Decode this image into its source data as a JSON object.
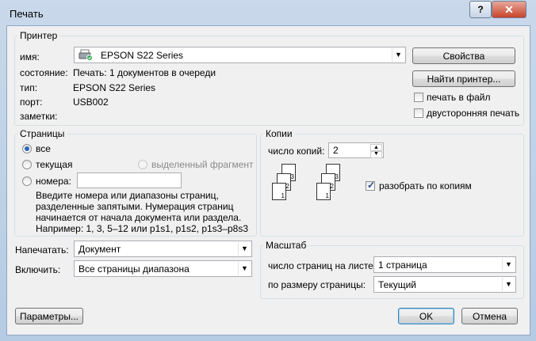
{
  "window": {
    "title": "Печать",
    "help_label": "?",
    "close_label": "✕"
  },
  "printer": {
    "group_label": "Принтер",
    "name_label": "имя:",
    "name_value": "EPSON S22 Series",
    "status_label": "состояние:",
    "status_value": "Печать: 1 документов в очереди",
    "type_label": "тип:",
    "type_value": "EPSON S22 Series",
    "port_label": "порт:",
    "port_value": "USB002",
    "notes_label": "заметки:",
    "properties_button": "Свойства",
    "find_button": "Найти принтер...",
    "print_to_file": {
      "label": "печать в файл",
      "checked": false
    },
    "duplex": {
      "label": "двусторонняя печать",
      "checked": false
    }
  },
  "pages": {
    "group_label": "Страницы",
    "all": {
      "label": "все",
      "selected": true
    },
    "current": {
      "label": "текущая",
      "selected": false
    },
    "selection": {
      "label": "выделенный фрагмент",
      "enabled": false
    },
    "numbers": {
      "label": "номера:",
      "value": ""
    },
    "hint_lines": [
      "Введите номера или диапазоны страниц,",
      "разделенные запятыми. Нумерация страниц",
      "начинается от начала документа или раздела.",
      "Например: 1, 3, 5–12 или p1s1, p1s2, p1s3–p8s3"
    ]
  },
  "copies": {
    "group_label": "Копии",
    "count_label": "число копий:",
    "count_value": "2",
    "collate": {
      "label": "разобрать по копиям",
      "checked": true
    },
    "page_numbers": [
      "3",
      "2",
      "1"
    ]
  },
  "print_what": {
    "label": "Напечатать:",
    "value": "Документ"
  },
  "include": {
    "label": "Включить:",
    "value": "Все страницы диапазона"
  },
  "zoom": {
    "group_label": "Масштаб",
    "pages_per_sheet_label": "число страниц на листе:",
    "pages_per_sheet_value": "1 страница",
    "scale_label": "по размеру страницы:",
    "scale_value": "Текущий"
  },
  "buttons": {
    "options": "Параметры...",
    "ok": "OK",
    "cancel": "Отмена"
  },
  "colors": {
    "accent": "#2a69b8",
    "frame": "#b5cbe3"
  }
}
